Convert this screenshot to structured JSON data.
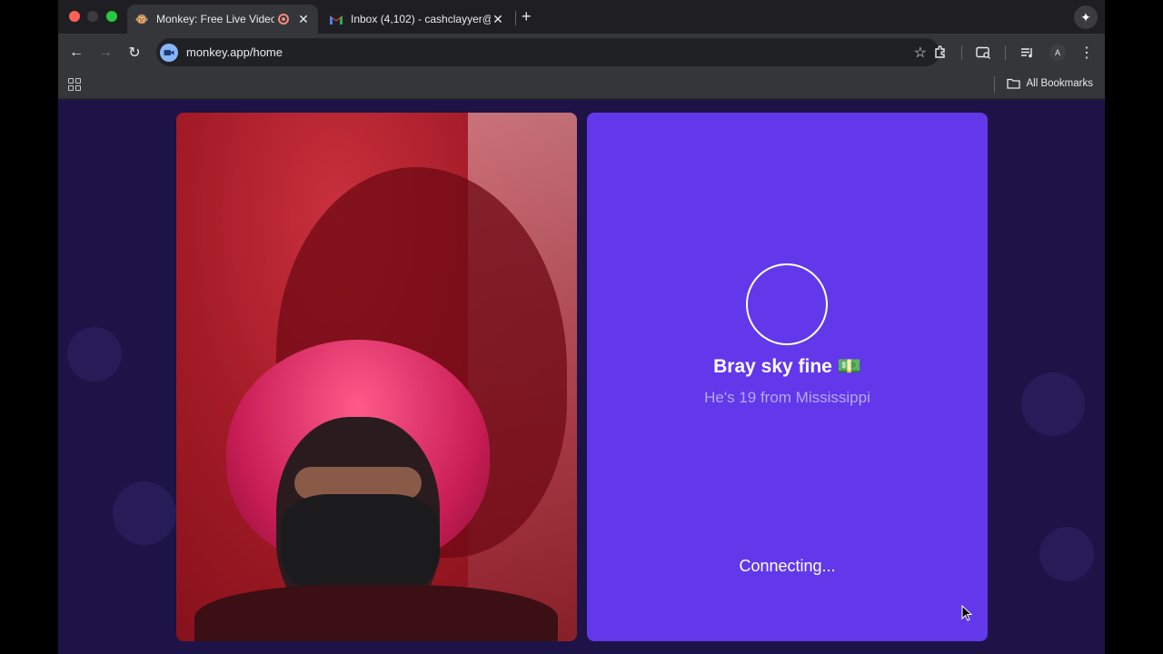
{
  "browser": {
    "tabs": [
      {
        "title": "Monkey: Free Live Video C",
        "favicon": "monkey-emoji",
        "active": true
      },
      {
        "title": "Inbox (4,102) - cashclayyer@",
        "favicon": "gmail-icon",
        "active": false
      }
    ],
    "url": "monkey.app/home",
    "bookmarks": {
      "all_label": "All Bookmarks"
    },
    "profile_initial": "A"
  },
  "match": {
    "name": "Bray sky fine 💵",
    "subtitle": "He's 19 from Mississippi",
    "status": "Connecting..."
  },
  "colors": {
    "panel": "#6238ea",
    "background": "#1d1347"
  }
}
